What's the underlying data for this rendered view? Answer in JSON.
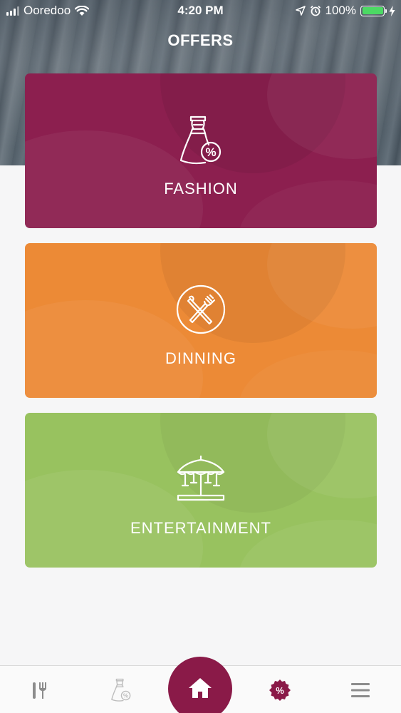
{
  "status_bar": {
    "carrier": "Ooredoo",
    "time": "4:20 PM",
    "battery_percent": "100%",
    "battery_level": 1.0
  },
  "header": {
    "title": "OFFERS"
  },
  "categories": [
    {
      "label": "FASHION",
      "icon": "dress-percent-icon",
      "color": "#8c1f4f"
    },
    {
      "label": "DINNING",
      "icon": "fork-knife-icon",
      "color": "#ec8a36"
    },
    {
      "label": "ENTERTAINMENT",
      "icon": "carousel-icon",
      "color": "#98c25f"
    }
  ],
  "bottom_nav": {
    "items": [
      {
        "icon": "fork-knife-icon"
      },
      {
        "icon": "dress-percent-icon"
      },
      {
        "icon": "home-icon",
        "active": true
      },
      {
        "icon": "percent-badge-icon"
      },
      {
        "icon": "menu-icon"
      }
    ],
    "accent_color": "#8a1a48"
  }
}
